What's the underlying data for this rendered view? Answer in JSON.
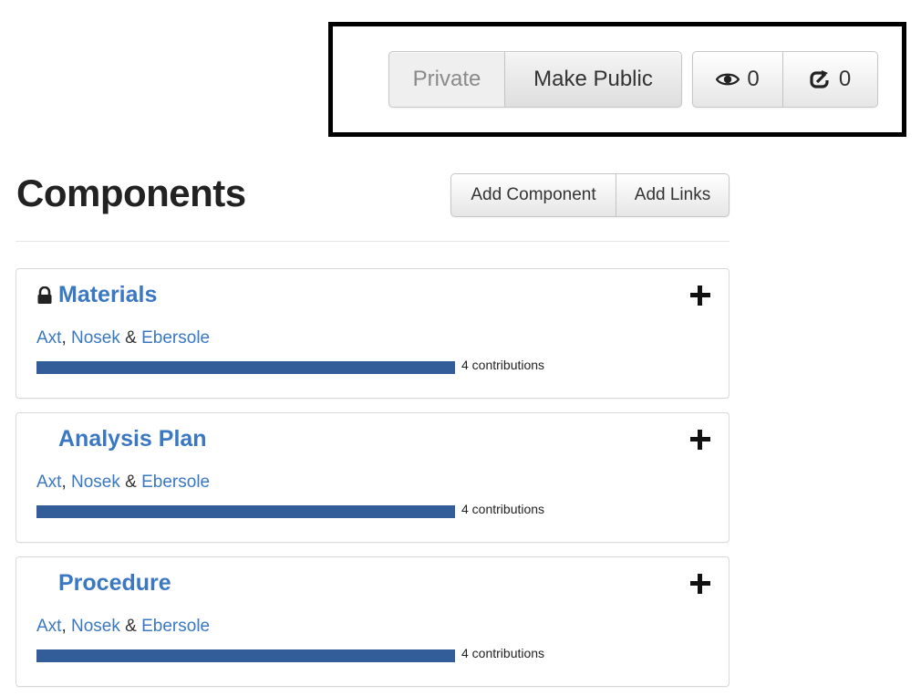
{
  "privacy": {
    "status_label": "Private",
    "make_public_label": "Make Public"
  },
  "counts": {
    "watch_count": "0",
    "fork_count": "0"
  },
  "components_section": {
    "title": "Components",
    "add_component_label": "Add Component",
    "add_links_label": "Add Links"
  },
  "components": [
    {
      "title": "Materials",
      "private": true,
      "contributors": [
        "Axt",
        "Nosek",
        "Ebersole"
      ],
      "separator_comma": ",",
      "separator_amp": "&",
      "contributions_label": "4 contributions",
      "contribution_fraction": 1.0
    },
    {
      "title": "Analysis Plan",
      "private": false,
      "contributors": [
        "Axt",
        "Nosek",
        "Ebersole"
      ],
      "separator_comma": ",",
      "separator_amp": "&",
      "contributions_label": "4 contributions",
      "contribution_fraction": 1.0
    },
    {
      "title": "Procedure",
      "private": false,
      "contributors": [
        "Axt",
        "Nosek",
        "Ebersole"
      ],
      "separator_comma": ",",
      "separator_amp": "&",
      "contributions_label": "4 contributions",
      "contribution_fraction": 1.0
    }
  ],
  "colors": {
    "link": "#3a78c3",
    "contribution_bar": "#335d99"
  },
  "icons": {
    "watch": "eye-icon",
    "fork": "fork-icon",
    "lock": "lock-icon",
    "add": "plus-icon"
  }
}
